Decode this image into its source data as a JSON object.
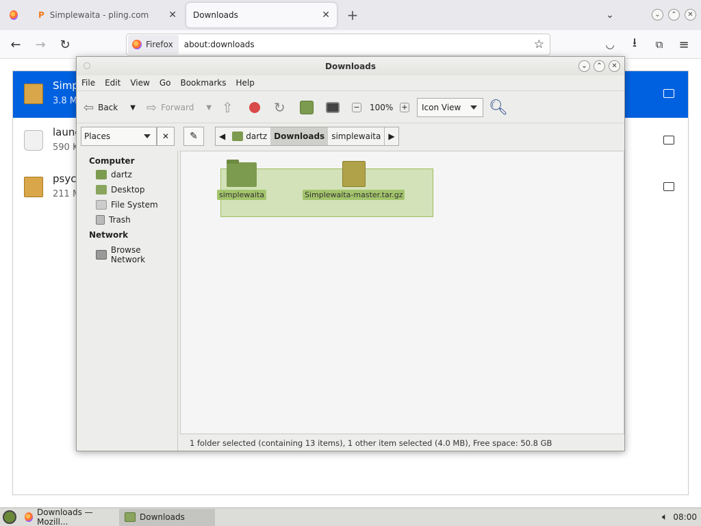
{
  "browser": {
    "tabs": [
      {
        "label": "Simplewaita - pling.com"
      },
      {
        "label": "Downloads"
      }
    ],
    "identity_label": "Firefox",
    "url": "about:downloads"
  },
  "downloads": {
    "items": [
      {
        "name": "Simp",
        "sub": "3.8 M"
      },
      {
        "name": "launc",
        "sub": "590 K"
      },
      {
        "name": "psych",
        "sub": "211 M"
      }
    ]
  },
  "filemanager": {
    "title": "Downloads",
    "menu": [
      "File",
      "Edit",
      "View",
      "Go",
      "Bookmarks",
      "Help"
    ],
    "toolbar": {
      "back": "Back",
      "forward": "Forward",
      "zoom": "100%",
      "view_mode": "Icon View"
    },
    "places_label": "Places",
    "breadcrumbs": [
      "dartz",
      "Downloads",
      "simplewaita"
    ],
    "sidebar": {
      "computer_header": "Computer",
      "computer_items": [
        "dartz",
        "Desktop",
        "File System",
        "Trash"
      ],
      "network_header": "Network",
      "network_items": [
        "Browse Network"
      ]
    },
    "files": [
      {
        "name": "simplewaita"
      },
      {
        "name": "Simplewaita-master.tar.gz"
      }
    ],
    "status": "1 folder selected (containing 13 items), 1 other item selected (4.0 MB), Free space: 50.8 GB"
  },
  "taskbar": {
    "items": [
      "Downloads — Mozill...",
      "Downloads"
    ],
    "clock": "08:00"
  },
  "colors": {
    "selection_blue": "#0061e0",
    "selection_green": "#a3c46c"
  }
}
